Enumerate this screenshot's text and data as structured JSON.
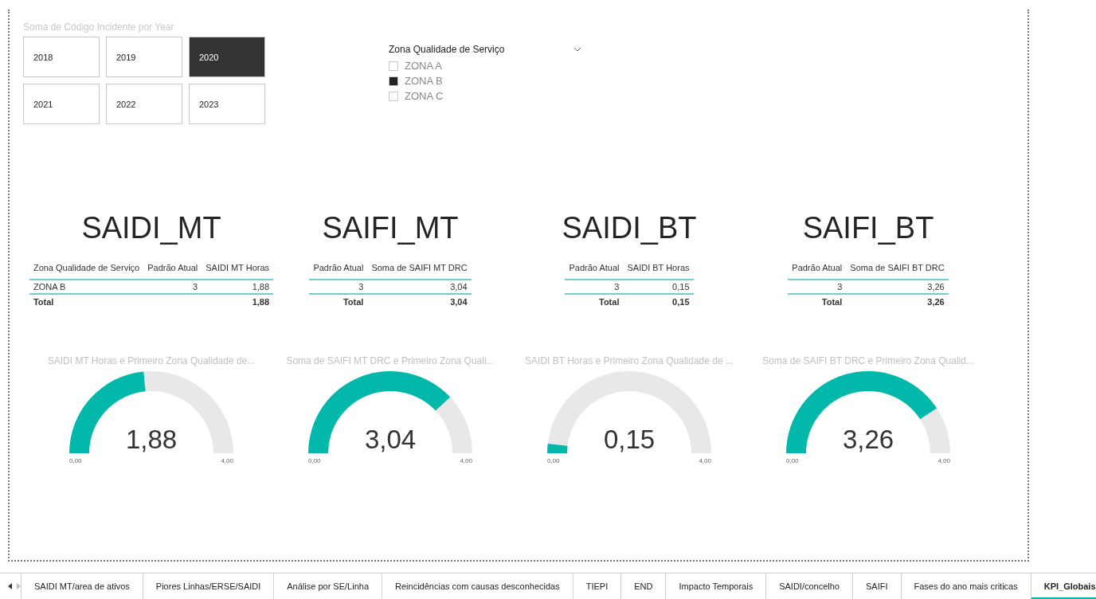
{
  "year_slicer": {
    "title": "Soma de Código Incidente por Year",
    "items": [
      {
        "label": "2018",
        "selected": false
      },
      {
        "label": "2019",
        "selected": false
      },
      {
        "label": "2020",
        "selected": true
      },
      {
        "label": "2021",
        "selected": false
      },
      {
        "label": "2022",
        "selected": false
      },
      {
        "label": "2023",
        "selected": false
      }
    ]
  },
  "zone_slicer": {
    "title": "Zona Qualidade de Serviço",
    "items": [
      {
        "label": "ZONA A",
        "checked": false
      },
      {
        "label": "ZONA B",
        "checked": true
      },
      {
        "label": "ZONA C",
        "checked": false
      }
    ]
  },
  "kpis": [
    {
      "title": "SAIDI_MT",
      "table": {
        "columns": [
          "Zona Qualidade de Serviço",
          "Padrão Atual",
          "SAIDI MT Horas"
        ],
        "rows": [
          [
            "ZONA B",
            "3",
            "1,88"
          ]
        ],
        "total": {
          "label": "Total",
          "value": "1,88"
        }
      },
      "gauge": {
        "title": "SAIDI MT Horas e Primeiro Zona Qualidade de...",
        "reading": "1,88",
        "min": "0,00",
        "max": "4,00"
      }
    },
    {
      "title": "SAIFI_MT",
      "table": {
        "columns": [
          "Padrão Atual",
          "Soma de SAIFI MT DRC"
        ],
        "rows": [
          [
            "3",
            "3,04"
          ]
        ],
        "total": {
          "label": "Total",
          "value": "3,04"
        }
      },
      "gauge": {
        "title": "Soma de SAIFI MT DRC e Primeiro Zona Quali...",
        "reading": "3,04",
        "min": "0,00",
        "max": "4,00"
      }
    },
    {
      "title": "SAIDI_BT",
      "table": {
        "columns": [
          "Padrão Atual",
          "SAIDI BT Horas"
        ],
        "rows": [
          [
            "3",
            "0,15"
          ]
        ],
        "total": {
          "label": "Total",
          "value": "0,15"
        }
      },
      "gauge": {
        "title": "SAIDI BT Horas e Primeiro Zona Qualidade de ...",
        "reading": "0,15",
        "min": "0,00",
        "max": "4,00"
      }
    },
    {
      "title": "SAIFI_BT",
      "table": {
        "columns": [
          "Padrão Atual",
          "Soma de SAIFI BT DRC"
        ],
        "rows": [
          [
            "3",
            "3,26"
          ]
        ],
        "total": {
          "label": "Total",
          "value": "3,26"
        }
      },
      "gauge": {
        "title": "Soma de SAIFI BT DRC e Primeiro Zona Qualid...",
        "reading": "3,26",
        "min": "0,00",
        "max": "4,00"
      }
    }
  ],
  "page_tabs": [
    {
      "label": "SAIDI MT/area de ativos",
      "selected": false
    },
    {
      "label": "Piores Linhas/ERSE/SAIDI",
      "selected": false
    },
    {
      "label": "Análise por SE/Linha",
      "selected": false
    },
    {
      "label": "Reincidências com causas desconhecidas",
      "selected": false
    },
    {
      "label": "TIEPI",
      "selected": false
    },
    {
      "label": "END",
      "selected": false
    },
    {
      "label": "Impacto Temporais",
      "selected": false
    },
    {
      "label": "SAIDI/concelho",
      "selected": false
    },
    {
      "label": "SAIFI",
      "selected": false
    },
    {
      "label": "Fases do ano mais criticas",
      "selected": false
    },
    {
      "label": "KPI_Globais",
      "selected": true
    }
  ]
}
